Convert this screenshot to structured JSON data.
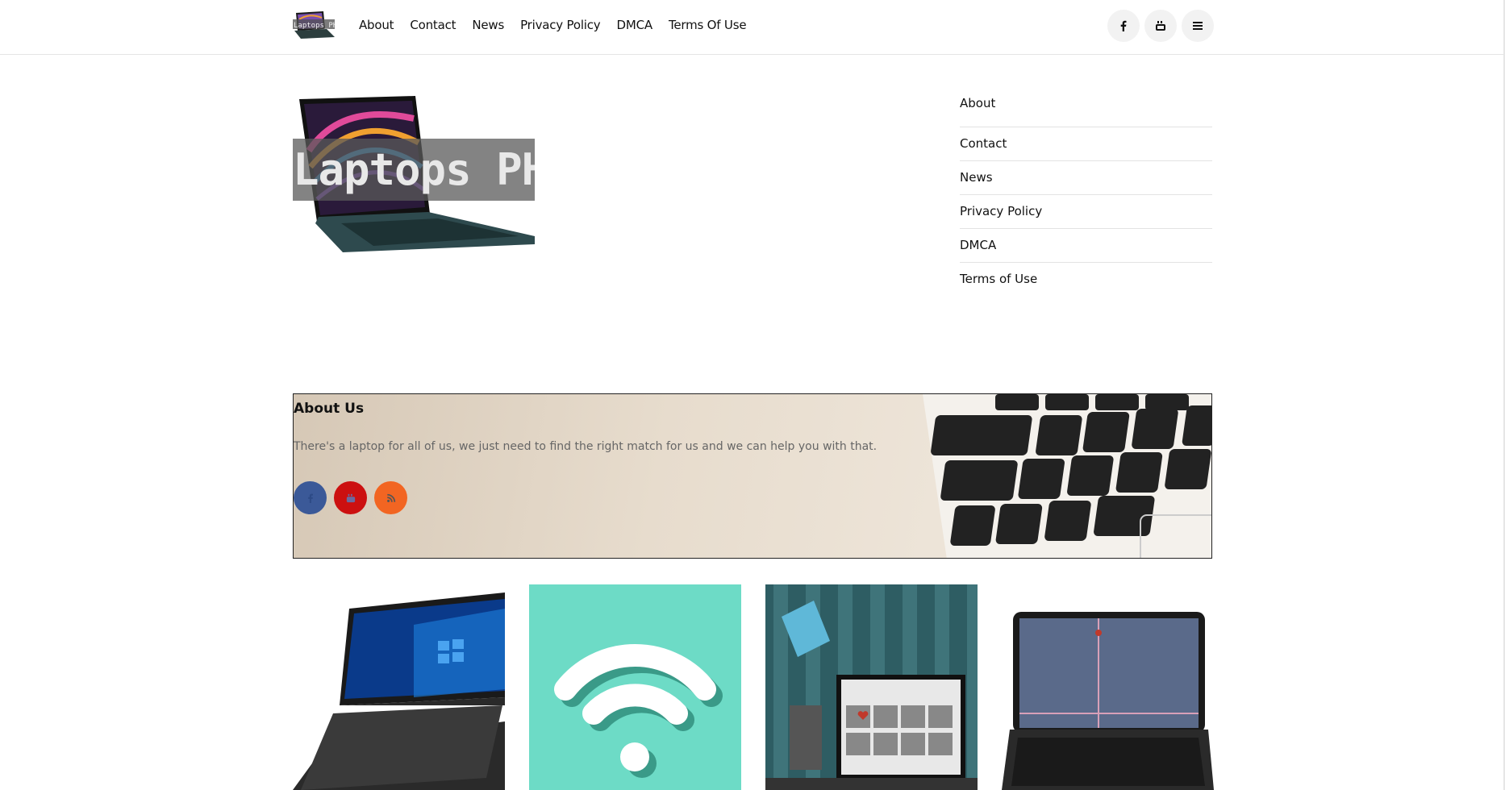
{
  "header": {
    "logo_text": "Laptops_PH",
    "nav": [
      "About",
      "Contact",
      "News",
      "Privacy Policy",
      "DMCA",
      "Terms Of Use"
    ],
    "icons": [
      "facebook-icon",
      "youtube-icon",
      "menu-icon"
    ]
  },
  "hero": {
    "logo_text": "Laptops PH"
  },
  "side_menu": [
    "About",
    "Contact",
    "News",
    "Privacy Policy",
    "DMCA",
    "Terms of Use"
  ],
  "about": {
    "title": "About Us",
    "text": "There's a laptop for all of us, we just need to find the right match for us and we can help you with that.",
    "socials": [
      "facebook-icon",
      "youtube-icon",
      "rss-icon"
    ]
  },
  "colors": {
    "facebook": "#3b5998",
    "youtube": "#cc1010",
    "rss": "#f26522",
    "wifi_bg": "#6ddbc6"
  }
}
